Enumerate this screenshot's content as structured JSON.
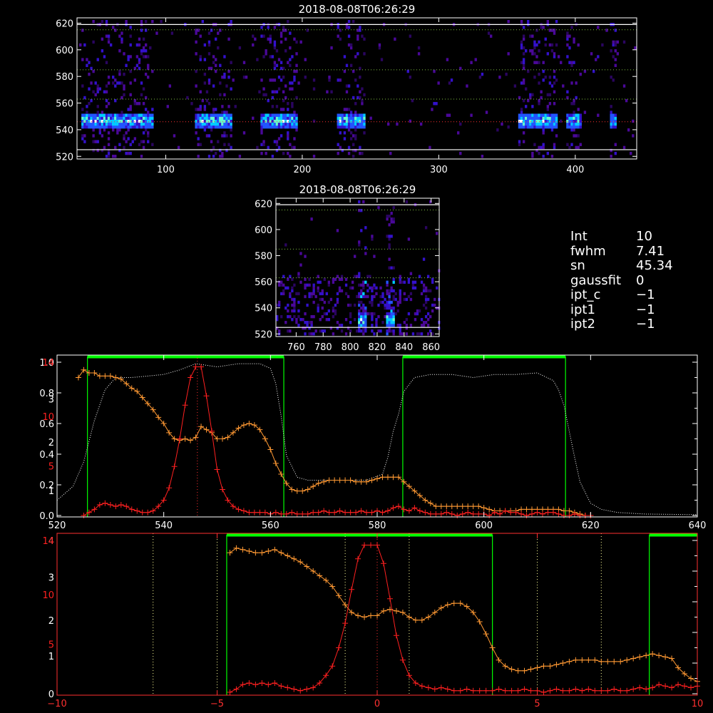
{
  "chart_data": [
    {
      "type": "heatmap",
      "title": "2018-08-08T06:26:29",
      "xlim": [
        35,
        445
      ],
      "ylim": [
        518,
        624
      ],
      "xticks": [
        100,
        200,
        300,
        400
      ],
      "yticks": [
        520,
        540,
        560,
        580,
        600,
        620
      ],
      "hlines_white": [
        525,
        619
      ],
      "hlines_green_dotted": [
        563,
        585,
        615
      ],
      "hline_red_dotted": 546,
      "bright_columns": [
        [
          37,
          90
        ],
        [
          120,
          147
        ],
        [
          168,
          195
        ],
        [
          224,
          245
        ],
        [
          358,
          386
        ],
        [
          393,
          404
        ],
        [
          425,
          430
        ]
      ],
      "emission_center": 546
    },
    {
      "type": "heatmap",
      "title": "2018-08-08T06:26:29",
      "xlim": [
        745,
        866
      ],
      "ylim": [
        518,
        624
      ],
      "xticks": [
        760,
        780,
        800,
        820,
        840,
        860
      ],
      "yticks": [
        520,
        540,
        560,
        580,
        600,
        620
      ],
      "hlines_white": [
        525,
        619
      ],
      "hlines_green_dotted": [
        563,
        585,
        615
      ],
      "bright_columns": [
        [
          805,
          812
        ],
        [
          826,
          832
        ]
      ],
      "emission_center": 530
    },
    {
      "type": "line",
      "xlim": [
        520,
        640
      ],
      "xticks": [
        520,
        540,
        560,
        580,
        600,
        620,
        640
      ],
      "yleft_ticks": [
        {
          "label": "0.0",
          "v": 0
        },
        {
          "label": "0.2",
          "v": 0.2
        },
        {
          "label": "0.4",
          "v": 0.4
        },
        {
          "label": "0.6",
          "v": 0.6
        },
        {
          "label": "0.8",
          "v": 0.8
        },
        {
          "label": "1.0",
          "v": 1.0
        }
      ],
      "yleft_ticks_orange": [
        {
          "label": "1",
          "v": 0.162
        },
        {
          "label": "2",
          "v": 0.478
        },
        {
          "label": "3",
          "v": 0.76
        },
        {
          "label": "4",
          "v": 1.0
        }
      ],
      "yleft_ticks_red": [
        {
          "label": "5",
          "v": 0.323
        },
        {
          "label": "10",
          "v": 0.646
        },
        {
          "label": "14",
          "v": 1.0
        }
      ],
      "green_boxes": [
        [
          525.7,
          562.5
        ],
        [
          584.8,
          615.3
        ]
      ],
      "red_dotted_x": 546.3,
      "series": [
        {
          "color": "#ffffff",
          "style": "dotted",
          "x": [
            520,
            523,
            525,
            527,
            529,
            531,
            534,
            537,
            540,
            543,
            546,
            550,
            554,
            558,
            560,
            561,
            562,
            563,
            565,
            567,
            570,
            574,
            578,
            581,
            582,
            583,
            584,
            585,
            587,
            590,
            594,
            598,
            602,
            606,
            610,
            613,
            614,
            615,
            616,
            617,
            618,
            620,
            622,
            625,
            630,
            640
          ],
          "y": [
            0.1,
            0.19,
            0.35,
            0.62,
            0.82,
            0.9,
            0.9,
            0.91,
            0.92,
            0.95,
            0.99,
            0.97,
            0.99,
            0.99,
            0.96,
            0.86,
            0.65,
            0.39,
            0.25,
            0.23,
            0.23,
            0.23,
            0.23,
            0.27,
            0.38,
            0.55,
            0.66,
            0.81,
            0.9,
            0.92,
            0.92,
            0.9,
            0.92,
            0.92,
            0.93,
            0.88,
            0.82,
            0.72,
            0.55,
            0.38,
            0.22,
            0.08,
            0.04,
            0.02,
            0.01,
            0.005
          ]
        },
        {
          "color": "#ff9933",
          "markers": "plus",
          "x": [
            524,
            525,
            526,
            527,
            528,
            529,
            530,
            531,
            532,
            533,
            534,
            535,
            536,
            537,
            538,
            539,
            540,
            541,
            542,
            543,
            544,
            545,
            546,
            547,
            548,
            549,
            550,
            551,
            552,
            553,
            554,
            555,
            556,
            557,
            558,
            559,
            560,
            561,
            562,
            563,
            564,
            565,
            566,
            567,
            568,
            569,
            570,
            571,
            572,
            573,
            574,
            575,
            576,
            577,
            578,
            579,
            580,
            581,
            582,
            583,
            584,
            585,
            586,
            587,
            588,
            589,
            590,
            591,
            592,
            593,
            594,
            595,
            596,
            597,
            598,
            599,
            600,
            601,
            602,
            603,
            604,
            605,
            606,
            607,
            608,
            609,
            610,
            611,
            612,
            613,
            614,
            615,
            616,
            617,
            618,
            619,
            620
          ],
          "y": [
            0.9,
            0.95,
            0.93,
            0.93,
            0.91,
            0.91,
            0.91,
            0.9,
            0.89,
            0.86,
            0.83,
            0.81,
            0.77,
            0.73,
            0.69,
            0.64,
            0.6,
            0.54,
            0.5,
            0.49,
            0.5,
            0.49,
            0.51,
            0.58,
            0.56,
            0.54,
            0.5,
            0.5,
            0.51,
            0.54,
            0.57,
            0.59,
            0.6,
            0.59,
            0.56,
            0.5,
            0.43,
            0.34,
            0.27,
            0.21,
            0.17,
            0.16,
            0.16,
            0.17,
            0.19,
            0.21,
            0.22,
            0.23,
            0.23,
            0.23,
            0.23,
            0.23,
            0.22,
            0.22,
            0.22,
            0.23,
            0.24,
            0.25,
            0.25,
            0.25,
            0.25,
            0.22,
            0.19,
            0.16,
            0.13,
            0.1,
            0.08,
            0.06,
            0.06,
            0.06,
            0.06,
            0.06,
            0.06,
            0.06,
            0.06,
            0.06,
            0.05,
            0.04,
            0.03,
            0.03,
            0.03,
            0.03,
            0.03,
            0.04,
            0.04,
            0.04,
            0.04,
            0.04,
            0.04,
            0.04,
            0.04,
            0.03,
            0.03,
            0.02,
            0.01,
            0.0,
            0.0
          ]
        },
        {
          "color": "#ff2020",
          "markers": "plus",
          "x": [
            525,
            526,
            527,
            528,
            529,
            530,
            531,
            532,
            533,
            534,
            535,
            536,
            537,
            538,
            539,
            540,
            541,
            542,
            543,
            544,
            545,
            546,
            547,
            548,
            549,
            550,
            551,
            552,
            553,
            554,
            555,
            556,
            557,
            558,
            559,
            560,
            561,
            562,
            563,
            564,
            565,
            566,
            567,
            568,
            569,
            570,
            571,
            572,
            573,
            574,
            575,
            576,
            577,
            578,
            579,
            580,
            581,
            582,
            583,
            584,
            585,
            586,
            587,
            588,
            589,
            590,
            591,
            592,
            593,
            594,
            595,
            596,
            597,
            598,
            599,
            600,
            601,
            602,
            603,
            604,
            605,
            606,
            607,
            608,
            609,
            610,
            611,
            612,
            613,
            614,
            615,
            616,
            617,
            618,
            619,
            620
          ],
          "y": [
            0.0,
            0.02,
            0.04,
            0.07,
            0.08,
            0.07,
            0.06,
            0.07,
            0.06,
            0.04,
            0.03,
            0.02,
            0.02,
            0.03,
            0.06,
            0.1,
            0.18,
            0.32,
            0.5,
            0.72,
            0.9,
            0.97,
            0.97,
            0.78,
            0.55,
            0.3,
            0.17,
            0.1,
            0.06,
            0.04,
            0.03,
            0.02,
            0.02,
            0.02,
            0.02,
            0.01,
            0.02,
            0.01,
            0.01,
            0.02,
            0.01,
            0.01,
            0.01,
            0.02,
            0.02,
            0.03,
            0.02,
            0.02,
            0.03,
            0.02,
            0.02,
            0.02,
            0.03,
            0.02,
            0.02,
            0.03,
            0.02,
            0.03,
            0.05,
            0.06,
            0.04,
            0.03,
            0.05,
            0.03,
            0.02,
            0.01,
            0.01,
            0.01,
            0.02,
            0.01,
            0.0,
            0.01,
            0.02,
            0.01,
            0.01,
            0.01,
            0.0,
            0.02,
            0.01,
            0.03,
            0.02,
            0.02,
            0.01,
            0.0,
            0.01,
            0.02,
            0.01,
            0.02,
            0.02,
            0.01,
            0.0,
            0.0,
            0.01,
            0.0,
            0.0,
            0.0
          ]
        }
      ]
    },
    {
      "type": "line",
      "xlim": [
        -10,
        10
      ],
      "xticks": [
        -10,
        -5,
        0,
        5,
        10
      ],
      "yleft_ticks_orange": [
        {
          "label": "0",
          "v": 0
        },
        {
          "label": "1",
          "v": 0.246
        },
        {
          "label": "2",
          "v": 0.479
        },
        {
          "label": "3",
          "v": 0.76
        },
        {
          "label": "4",
          "v": 1.0
        }
      ],
      "yleft_ticks_red": [
        {
          "label": "5",
          "v": 0.323
        },
        {
          "label": "10",
          "v": 0.646
        },
        {
          "label": "14",
          "v": 1.0
        }
      ],
      "green_boxes": [
        [
          -4.7,
          3.6
        ],
        [
          8.5,
          11.0
        ]
      ],
      "white_dotted_x": [
        -7,
        -5,
        -1,
        1,
        5,
        7
      ],
      "red_dotted_x": 0,
      "series": [
        {
          "color": "#ff9933",
          "markers": "plus",
          "x": [
            -4.6,
            -4.4,
            -4.2,
            -4.0,
            -3.8,
            -3.6,
            -3.4,
            -3.2,
            -3.0,
            -2.8,
            -2.6,
            -2.4,
            -2.2,
            -2.0,
            -1.8,
            -1.6,
            -1.4,
            -1.2,
            -1.0,
            -0.8,
            -0.6,
            -0.4,
            -0.2,
            0.0,
            0.2,
            0.4,
            0.6,
            0.8,
            1.0,
            1.2,
            1.4,
            1.6,
            1.8,
            2.0,
            2.2,
            2.4,
            2.6,
            2.8,
            3.0,
            3.2,
            3.4,
            3.6,
            3.8,
            4.0,
            4.2,
            4.4,
            4.6,
            4.8,
            5.0,
            5.2,
            5.4,
            5.6,
            5.8,
            6.0,
            6.2,
            6.4,
            6.6,
            6.8,
            7.0,
            7.2,
            7.4,
            7.6,
            7.8,
            8.0,
            8.2,
            8.4,
            8.6,
            8.8,
            9.0,
            9.2,
            9.4,
            9.6,
            9.8,
            10.0
          ],
          "y": [
            0.92,
            0.95,
            0.94,
            0.93,
            0.92,
            0.92,
            0.93,
            0.94,
            0.92,
            0.9,
            0.88,
            0.86,
            0.83,
            0.8,
            0.77,
            0.74,
            0.7,
            0.64,
            0.58,
            0.53,
            0.51,
            0.5,
            0.51,
            0.51,
            0.54,
            0.55,
            0.54,
            0.53,
            0.5,
            0.48,
            0.48,
            0.5,
            0.53,
            0.56,
            0.58,
            0.59,
            0.59,
            0.57,
            0.53,
            0.47,
            0.39,
            0.3,
            0.22,
            0.18,
            0.16,
            0.15,
            0.15,
            0.16,
            0.17,
            0.18,
            0.18,
            0.19,
            0.2,
            0.21,
            0.22,
            0.22,
            0.22,
            0.22,
            0.21,
            0.21,
            0.21,
            0.21,
            0.22,
            0.23,
            0.24,
            0.25,
            0.26,
            0.25,
            0.24,
            0.23,
            0.17,
            0.13,
            0.1,
            0.08
          ]
        },
        {
          "color": "#ff2020",
          "markers": "plus",
          "x": [
            -4.6,
            -4.4,
            -4.2,
            -4.0,
            -3.8,
            -3.6,
            -3.4,
            -3.2,
            -3.0,
            -2.8,
            -2.6,
            -2.4,
            -2.2,
            -2.0,
            -1.8,
            -1.6,
            -1.4,
            -1.2,
            -1.0,
            -0.8,
            -0.6,
            -0.4,
            -0.2,
            0.0,
            0.2,
            0.4,
            0.6,
            0.8,
            1.0,
            1.2,
            1.4,
            1.6,
            1.8,
            2.0,
            2.2,
            2.4,
            2.6,
            2.8,
            3.0,
            3.2,
            3.4,
            3.6,
            3.8,
            4.0,
            4.2,
            4.4,
            4.6,
            4.8,
            5.0,
            5.2,
            5.4,
            5.6,
            5.8,
            6.0,
            6.2,
            6.4,
            6.6,
            6.8,
            7.0,
            7.2,
            7.4,
            7.6,
            7.8,
            8.0,
            8.2,
            8.4,
            8.6,
            8.8,
            9.0,
            9.2,
            9.4,
            9.6,
            9.8,
            10.0
          ],
          "y": [
            0.01,
            0.03,
            0.06,
            0.07,
            0.06,
            0.07,
            0.06,
            0.07,
            0.05,
            0.04,
            0.03,
            0.02,
            0.03,
            0.04,
            0.07,
            0.12,
            0.18,
            0.3,
            0.46,
            0.68,
            0.88,
            0.97,
            0.97,
            0.97,
            0.85,
            0.62,
            0.38,
            0.22,
            0.12,
            0.07,
            0.05,
            0.04,
            0.03,
            0.04,
            0.03,
            0.02,
            0.02,
            0.03,
            0.02,
            0.02,
            0.02,
            0.02,
            0.03,
            0.02,
            0.02,
            0.02,
            0.03,
            0.02,
            0.02,
            0.01,
            0.02,
            0.03,
            0.02,
            0.02,
            0.03,
            0.02,
            0.03,
            0.02,
            0.02,
            0.02,
            0.03,
            0.02,
            0.02,
            0.03,
            0.04,
            0.03,
            0.04,
            0.06,
            0.05,
            0.04,
            0.06,
            0.05,
            0.04,
            0.05
          ]
        }
      ]
    }
  ],
  "info_panel": {
    "items": [
      {
        "key": "Int",
        "value": "10"
      },
      {
        "key": "fwhm",
        "value": "7.41"
      },
      {
        "key": "sn",
        "value": "45.34"
      },
      {
        "key": "gaussfit",
        "value": "0"
      },
      {
        "key": "ipt_c",
        "value": "−1"
      },
      {
        "key": "ipt1",
        "value": "−1"
      },
      {
        "key": "ipt2",
        "value": "−1"
      }
    ]
  },
  "colors": {
    "axis": "#ffffff",
    "green_box": "#00ff00",
    "orange_series": "#ff9933",
    "red_series": "#ff2020",
    "grid_green": "#80c040"
  }
}
